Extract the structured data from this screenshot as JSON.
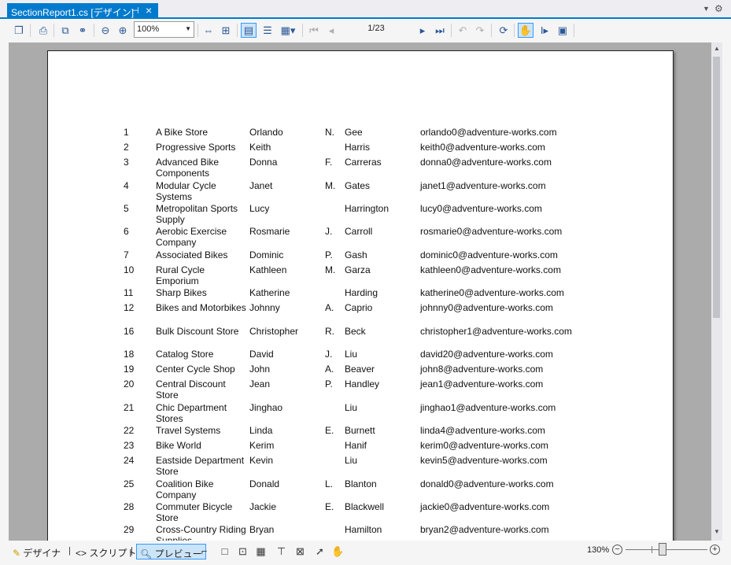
{
  "tab": {
    "title": "SectionReport1.cs [デザイン]",
    "pin_icon": "pin-icon",
    "close_icon": "close-icon"
  },
  "toolbar": {
    "zoom_value": "100%",
    "page_indicator": "1/23",
    "icons": [
      "table-of-contents-icon",
      "print-icon",
      "copy-icon",
      "find-icon",
      "zoom-out-icon",
      "zoom-in-icon",
      "fit-width-icon",
      "fit-page-icon",
      "single-page-icon",
      "continuous-icon",
      "multipage-icon",
      "first-page-icon",
      "previous-page-icon",
      "next-page-icon",
      "last-page-icon",
      "back-icon",
      "forward-icon",
      "refresh-icon",
      "pan-icon",
      "select-icon",
      "snapshot-icon"
    ]
  },
  "report": {
    "rows": [
      {
        "id": "1",
        "company": "A Bike Store",
        "first": "Orlando",
        "mi": "N.",
        "last": "Gee",
        "email": "orlando0@adventure-works.com"
      },
      {
        "id": "2",
        "company": "Progressive Sports",
        "first": "Keith",
        "mi": "",
        "last": "Harris",
        "email": "keith0@adventure-works.com"
      },
      {
        "id": "3",
        "company": "Advanced Bike Components",
        "first": "Donna",
        "mi": "F.",
        "last": "Carreras",
        "email": "donna0@adventure-works.com"
      },
      {
        "id": "4",
        "company": "Modular Cycle Systems",
        "first": "Janet",
        "mi": "M.",
        "last": "Gates",
        "email": "janet1@adventure-works.com"
      },
      {
        "id": "5",
        "company": "Metropolitan Sports Supply",
        "first": "Lucy",
        "mi": "",
        "last": "Harrington",
        "email": "lucy0@adventure-works.com"
      },
      {
        "id": "6",
        "company": "Aerobic Exercise Company",
        "first": "Rosmarie",
        "mi": "J.",
        "last": "Carroll",
        "email": "rosmarie0@adventure-works.com"
      },
      {
        "id": "7",
        "company": "Associated Bikes",
        "first": "Dominic",
        "mi": "P.",
        "last": "Gash",
        "email": "dominic0@adventure-works.com"
      },
      {
        "id": "10",
        "company": "Rural Cycle Emporium",
        "first": "Kathleen",
        "mi": "M.",
        "last": "Garza",
        "email": "kathleen0@adventure-works.com"
      },
      {
        "id": "11",
        "company": "Sharp Bikes",
        "first": "Katherine",
        "mi": "",
        "last": "Harding",
        "email": "katherine0@adventure-works.com"
      },
      {
        "id": "12",
        "company": "Bikes and Motorbikes",
        "first": "Johnny",
        "mi": "A.",
        "last": "Caprio",
        "email": "johnny0@adventure-works.com"
      },
      {
        "id": "16",
        "company": "Bulk Discount Store",
        "first": "Christopher",
        "mi": "R.",
        "last": "Beck",
        "email": "christopher1@adventure-works.com"
      },
      {
        "id": "18",
        "company": "Catalog Store",
        "first": "David",
        "mi": "J.",
        "last": "Liu",
        "email": "david20@adventure-works.com"
      },
      {
        "id": "19",
        "company": "Center Cycle Shop",
        "first": "John",
        "mi": "A.",
        "last": "Beaver",
        "email": "john8@adventure-works.com"
      },
      {
        "id": "20",
        "company": "Central Discount Store",
        "first": "Jean",
        "mi": "P.",
        "last": "Handley",
        "email": "jean1@adventure-works.com"
      },
      {
        "id": "21",
        "company": "Chic Department Stores",
        "first": "Jinghao",
        "mi": "",
        "last": "Liu",
        "email": "jinghao1@adventure-works.com"
      },
      {
        "id": "22",
        "company": "Travel Systems",
        "first": "Linda",
        "mi": "E.",
        "last": "Burnett",
        "email": "linda4@adventure-works.com"
      },
      {
        "id": "23",
        "company": "Bike World",
        "first": "Kerim",
        "mi": "",
        "last": "Hanif",
        "email": "kerim0@adventure-works.com"
      },
      {
        "id": "24",
        "company": "Eastside Department Store",
        "first": "Kevin",
        "mi": "",
        "last": "Liu",
        "email": "kevin5@adventure-works.com"
      },
      {
        "id": "25",
        "company": "Coalition Bike Company",
        "first": "Donald",
        "mi": "L.",
        "last": "Blanton",
        "email": "donald0@adventure-works.com"
      },
      {
        "id": "28",
        "company": "Commuter Bicycle Store",
        "first": "Jackie",
        "mi": "E.",
        "last": "Blackwell",
        "email": "jackie0@adventure-works.com"
      },
      {
        "id": "29",
        "company": "Cross-Country Riding Supplies",
        "first": "Bryan",
        "mi": "",
        "last": "Hamilton",
        "email": "bryan2@adventure-works.com"
      }
    ]
  },
  "statusbar": {
    "designer_label": "デザイナ",
    "script_label": "スクリプト",
    "preview_label": "プレビュー",
    "zoom_level": "130%",
    "zoom_minus": "−",
    "zoom_plus": "+"
  },
  "colors": {
    "accent": "#007acc",
    "viewer_bg": "#ababab"
  }
}
